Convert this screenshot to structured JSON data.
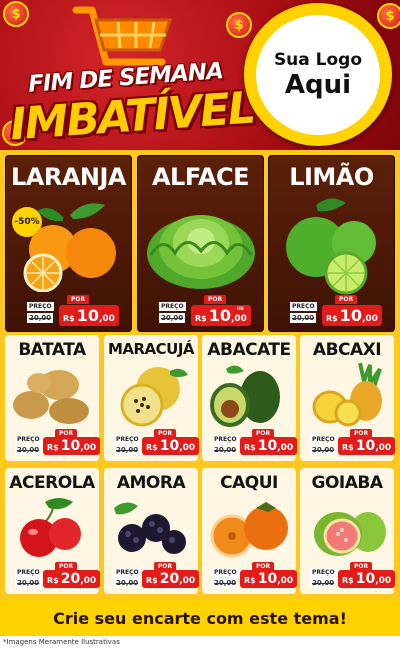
{
  "header": {
    "title_line1": "FIM DE SEMANA",
    "title_line2": "IMBATÍVEL",
    "logo_line1": "Sua Logo",
    "logo_line2": "Aqui",
    "coin_symbol": "$"
  },
  "colors": {
    "red": "#a90e14",
    "yellow": "#ffd200",
    "brown": "#4a1706",
    "price_red": "#e21b1b"
  },
  "price_labels": {
    "preco": "PREÇO",
    "por": "POR",
    "currency": "R$",
    "unit": "UN"
  },
  "featured": [
    {
      "name": "LARANJA",
      "badge": "-50%",
      "old_price": "20,00",
      "price_int": "10",
      "price_dec": ",00",
      "icon": "orange-icon"
    },
    {
      "name": "ALFACE",
      "old_price": "20,00",
      "price_int": "10",
      "price_dec": ",00",
      "icon": "lettuce-icon"
    },
    {
      "name": "LIMÃO",
      "old_price": "20,00",
      "price_int": "10",
      "price_dec": ",00",
      "icon": "lime-icon"
    }
  ],
  "products": [
    {
      "name": "BATATA",
      "old_price": "20,00",
      "price_int": "10",
      "price_dec": ",00",
      "icon": "potato-icon"
    },
    {
      "name": "MARACUJÁ",
      "old_price": "20,00",
      "price_int": "10",
      "price_dec": ",00",
      "icon": "passionfruit-icon"
    },
    {
      "name": "ABACATE",
      "old_price": "20,00",
      "price_int": "10",
      "price_dec": ",00",
      "icon": "avocado-icon"
    },
    {
      "name": "ABCAXI",
      "old_price": "20,00",
      "price_int": "10",
      "price_dec": ",00",
      "icon": "pineapple-icon"
    },
    {
      "name": "ACEROLA",
      "old_price": "20,00",
      "price_int": "20",
      "price_dec": ",00",
      "icon": "acerola-icon"
    },
    {
      "name": "AMORA",
      "old_price": "20,00",
      "price_int": "20",
      "price_dec": ",00",
      "icon": "blackberry-icon"
    },
    {
      "name": "CAQUI",
      "old_price": "20,00",
      "price_int": "10",
      "price_dec": ",00",
      "icon": "persimmon-icon"
    },
    {
      "name": "GOIABA",
      "old_price": "20,00",
      "price_int": "10",
      "price_dec": ",00",
      "icon": "guava-icon"
    }
  ],
  "footer": {
    "cta": "Crie seu encarte com este tema!",
    "disclaimer": "*Imagens Meramente Ilustrativas"
  }
}
